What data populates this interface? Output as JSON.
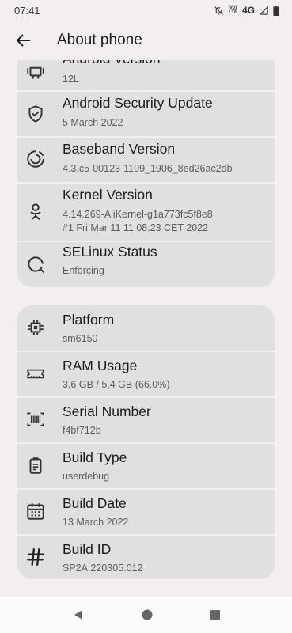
{
  "status": {
    "time": "07:41",
    "volte_top": "Vo)",
    "volte_bottom": "LTE",
    "network": "4G"
  },
  "header": {
    "title": "About phone"
  },
  "card1": {
    "items": [
      {
        "title": "Android Version",
        "sub": "12L",
        "icon": "android-icon"
      },
      {
        "title": "Android Security Update",
        "sub": "5 March 2022",
        "icon": "shield-check-icon"
      },
      {
        "title": "Baseband Version",
        "sub": "4.3.c5-00123-1109_1906_8ed26ac2db",
        "icon": "baseband-icon"
      },
      {
        "title": "Kernel Version",
        "sub": "4.14.269-AliKernel-g1a773fc5f8e8",
        "sub2": "#1 Fri Mar 11 11:08:23 CET 2022",
        "icon": "kernel-icon"
      },
      {
        "title": "SELinux Status",
        "sub": "Enforcing",
        "icon": "selinux-icon"
      }
    ]
  },
  "card2": {
    "items": [
      {
        "title": "Platform",
        "sub": "sm6150",
        "icon": "chip-icon"
      },
      {
        "title": "RAM Usage",
        "sub": "3,6 GB / 5,4 GB (66.0%)",
        "icon": "ram-icon"
      },
      {
        "title": "Serial Number",
        "sub": "f4bf712b",
        "icon": "barcode-icon"
      },
      {
        "title": "Build Type",
        "sub": "userdebug",
        "icon": "clipboard-icon"
      },
      {
        "title": "Build Date",
        "sub": "13 March 2022",
        "icon": "calendar-icon"
      },
      {
        "title": "Build ID",
        "sub": "SP2A.220305.012",
        "icon": "hash-icon"
      }
    ]
  }
}
